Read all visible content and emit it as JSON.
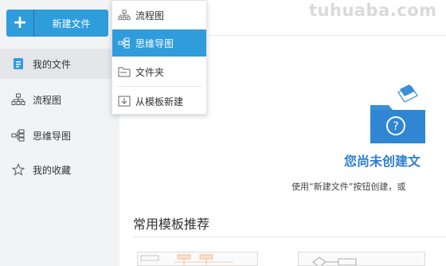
{
  "sidebar": {
    "new_button_label": "新建文件",
    "items": [
      {
        "label": "我的文件",
        "icon": "document-icon"
      },
      {
        "label": "流程图",
        "icon": "flowchart-icon"
      },
      {
        "label": "思维导图",
        "icon": "mindmap-icon"
      },
      {
        "label": "我的收藏",
        "icon": "star-icon"
      }
    ]
  },
  "dropdown": {
    "items": [
      {
        "label": "流程图",
        "icon": "flowchart-icon"
      },
      {
        "label": "思维导图",
        "icon": "mindmap-icon"
      },
      {
        "label": "文件夹",
        "icon": "folder-icon"
      },
      {
        "label": "从模板新建",
        "icon": "template-icon"
      }
    ]
  },
  "main": {
    "watermark": "tuhuaba.com",
    "empty_title": "您尚未创建文",
    "empty_hint": "使用“新建文件”按钮创建，或",
    "templates_title": "常用模板推荐"
  },
  "colors": {
    "accent": "#2f9cdc",
    "sidebar_bg": "#f2f3f4",
    "title_blue": "#2e7fd0"
  }
}
